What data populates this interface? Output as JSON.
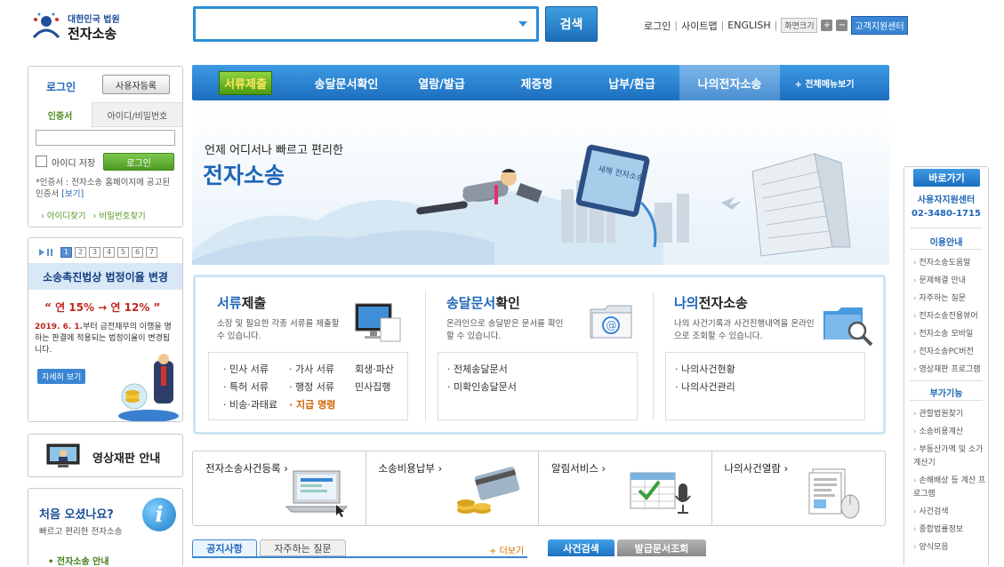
{
  "header": {
    "logo_top": "대한민국 법원",
    "logo_main": "전자소송",
    "search_placeholder": "",
    "search_button": "검색",
    "links": [
      "로그인",
      "사이트맵",
      "ENGLISH"
    ],
    "font_size_label": "화면크기",
    "font_plus": "+",
    "font_minus": "−",
    "help_center": "고객지원센터"
  },
  "login": {
    "title": "로그인",
    "register": "사용자등록",
    "tab_cert": "인증서",
    "tab_id": "아이디/비밀번호",
    "save_id": "아이디 저장",
    "login_button": "로그인",
    "note": "*인증서 : 전자소송 홈페이지에 공고된 인증서",
    "note_link": "[보기]",
    "find_id": "아이디찾기",
    "find_pw": "비밀번호찾기"
  },
  "banner": {
    "pages": [
      "1",
      "2",
      "3",
      "4",
      "5",
      "6",
      "7"
    ],
    "active_page": "1",
    "heading": "소송촉진법상 법정이율 변경",
    "rate": "“ 연 15% → 연 12% ”",
    "desc_1": "2019. 6. 1.",
    "desc_2": "부터 금전채무의 이행을 명하는 판결에 적용되는 법정이율이 변경됩니다.",
    "more": "자세히 보기"
  },
  "video": {
    "label": "영상재판 안내"
  },
  "first_visit": {
    "title": "처음 오셨나요?",
    "subtitle": "빠르고 편리한 전자소송",
    "info_glyph": "i",
    "link": "• 전자소송 안내"
  },
  "nav": {
    "items": [
      "서류제출",
      "송달문서확인",
      "열람/발급",
      "제증명",
      "납부/환급",
      "나의전자소송"
    ],
    "all_menu": "+ 전체메뉴보기"
  },
  "hero": {
    "tagline": "언제 어디서나 빠르고 편리한",
    "title": "전자소송",
    "sign_text": "새해 전자소송"
  },
  "services": [
    {
      "title_bold": "서류",
      "title_rest": "제출",
      "desc": "소장 및 필요한 각종 서류를 제출할 수 있습니다.",
      "items": [
        "· 민사 서류",
        "· 가사 서류",
        "회생·파산",
        "· 특허 서류",
        "· 행정 서류",
        "민사집행",
        "· 비송·과태료",
        "· 지급 명령"
      ]
    },
    {
      "title_bold": "송달문서",
      "title_rest": "확인",
      "desc": "온라인으로 송달받은 문서를 확인 할 수 있습니다.",
      "items": [
        "· 전체송달문서",
        "· 미확인송달문서"
      ]
    },
    {
      "title_bold": "나의",
      "title_rest": "전자소송",
      "desc": "나의 사건기록과 사건진행내역을 온라인으로 조회할 수 있습니다.",
      "items": [
        "· 나의사건현황",
        "· 나의사건관리"
      ]
    }
  ],
  "quick": [
    "전자소송사건등록 ›",
    "소송비용납부 ›",
    "알림서비스 ›",
    "나의사건열람 ›"
  ],
  "bottom_tabs": {
    "notice": "공지사항",
    "faq": "자주하는 질문",
    "more": "더보기",
    "more_mark": "+",
    "case_search": "사건검색",
    "doc_check": "발급문서조회"
  },
  "right_menu": {
    "head": "바로가기",
    "center_name": "사용자지원센터",
    "center_phone": "02-3480-1715",
    "section1": "이용안내",
    "items1": [
      "전자소송도움말",
      "문제해결 안내",
      "자주하는 질문",
      "전자소송전용뷰어",
      "전자소송 모바일",
      "전자소송PC버전",
      "영상재판 프로그램"
    ],
    "section2": "부가기능",
    "items2": [
      "관할법원찾기",
      "소송비용계산",
      "부동산가액 및 소가계산기",
      "손해배상 등 계산 프로그램",
      "사건검색",
      "종합법률정보",
      "양식모음"
    ]
  }
}
